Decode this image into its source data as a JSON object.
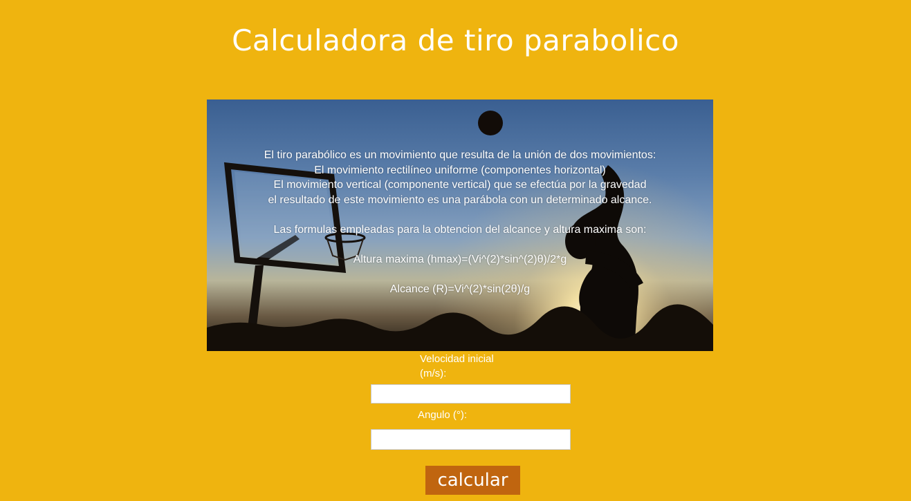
{
  "page": {
    "title": "Calculadora de tiro parabolico"
  },
  "hero": {
    "lines": [
      "El tiro parabólico es un movimiento que resulta de la unión de dos movimientos:",
      "El movimiento rectilíneo uniforme (componentes horizontal)",
      "El movimiento vertical (componente vertical) que se efectúa por la gravedad",
      "el resultado de este movimiento es una parábola con un determinado alcance.",
      "Las formulas empleadas para la obtencion del alcance y altura maxima son:",
      "Altura maxima (hmax)=(Vi^(2)*sin^(2)θ)/2*g",
      "Alcance (R)=Vi^(2)*sin(2θ)/g"
    ],
    "image_subject": "basketball-player-silhouette-sunset"
  },
  "form": {
    "velocidad_label": "Velocidad inicial (m/s):",
    "velocidad_value": "",
    "angulo_label": "Angulo (°):",
    "angulo_value": "",
    "submit_label": "calcular"
  },
  "colors": {
    "background": "#efb40f",
    "button": "#c0650f",
    "text": "#ffffff"
  }
}
